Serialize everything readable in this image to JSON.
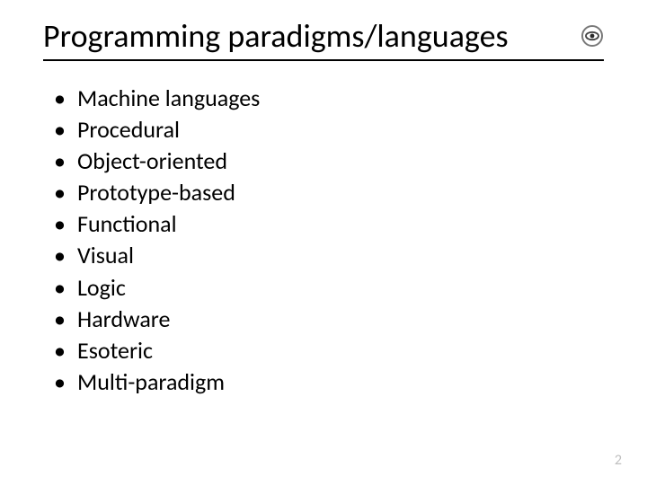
{
  "title": "Programming paradigms/languages",
  "bullets": [
    "Machine languages",
    "Procedural",
    "Object-oriented",
    "Prototype-based",
    "Functional",
    "Visual",
    "Logic",
    "Hardware",
    "Esoteric",
    "Multi-paradigm"
  ],
  "page_number": "2"
}
